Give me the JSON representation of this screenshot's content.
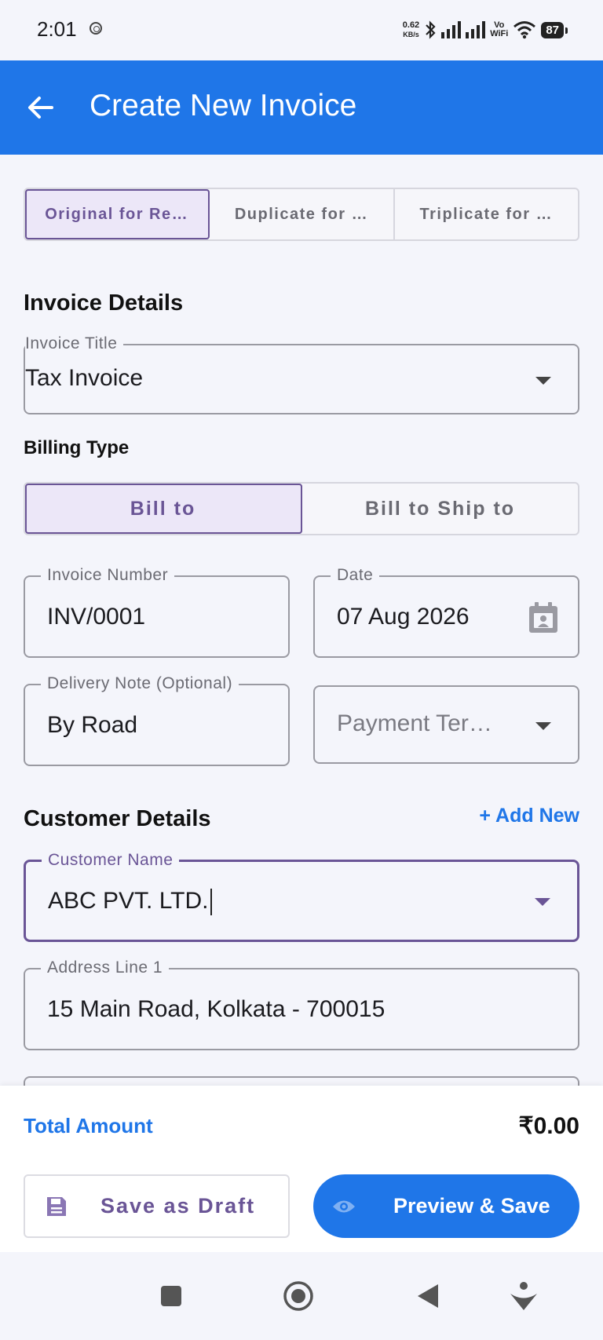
{
  "status": {
    "time": "2:01",
    "net_speed": "0.62",
    "net_unit": "KB/s",
    "vowifi_top": "Vo",
    "vowifi_bottom": "WiFi",
    "battery": "87"
  },
  "app_bar": {
    "title": "Create New Invoice",
    "back_icon": "arrow-left-icon",
    "color": "#1f76e8"
  },
  "copy_tabs": [
    {
      "label": "Original for Re…",
      "active": true
    },
    {
      "label": "Duplicate for …",
      "active": false
    },
    {
      "label": "Triplicate for …",
      "active": false
    }
  ],
  "invoice_details": {
    "heading": "Invoice Details",
    "invoice_title": {
      "label": "Invoice Title",
      "value": "Tax Invoice"
    },
    "billing_type": {
      "heading": "Billing Type",
      "options": [
        {
          "label": "Bill to",
          "active": true
        },
        {
          "label": "Bill to Ship to",
          "active": false
        }
      ]
    },
    "invoice_number": {
      "label": "Invoice Number",
      "value": "INV/0001"
    },
    "date": {
      "label": "Date",
      "value": "07 Aug 2026",
      "icon": "calendar-icon"
    },
    "delivery_note": {
      "label": "Delivery Note (Optional)",
      "value": "By Road"
    },
    "payment_terms": {
      "placeholder": "Payment Ter…"
    }
  },
  "customer_details": {
    "heading": "Customer Details",
    "add_new": "+ Add New",
    "customer_name": {
      "label": "Customer Name",
      "value": "ABC PVT. LTD."
    },
    "address_line_1": {
      "label": "Address Line 1",
      "value": "15 Main Road, Kolkata - 700015"
    }
  },
  "footer": {
    "total_label": "Total Amount",
    "total_value": "₹0.00",
    "draft_button": {
      "label": "Save as Draft",
      "icon": "save-icon"
    },
    "preview_button": {
      "label": "Preview & Save",
      "icon": "eye-icon"
    }
  },
  "nav": {
    "items": [
      "recents-icon",
      "home-icon",
      "back-icon",
      "assist-icon"
    ]
  },
  "colors": {
    "primary": "#1f76e8",
    "accent_purple": "#6a5596",
    "selected_bg": "#ece7f8"
  }
}
